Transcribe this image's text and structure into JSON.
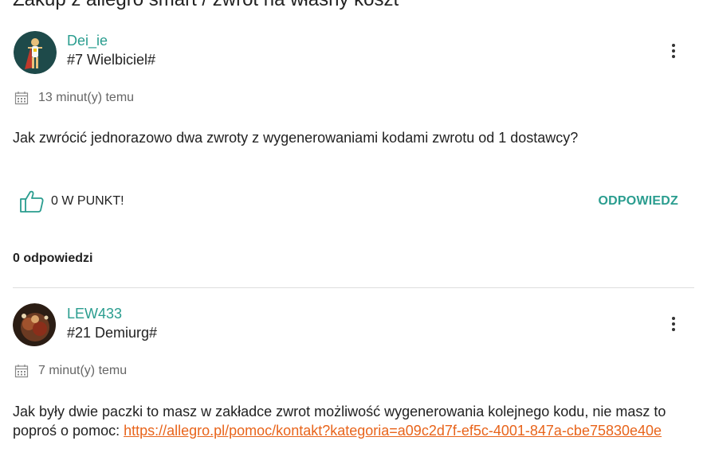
{
  "thread": {
    "title": "Zakup z allegro smart / zwrot na własny koszt"
  },
  "question": {
    "author": {
      "name": "Dei_ie",
      "rank": "#7 Wielbiciel#"
    },
    "time": "13 minut(y) temu",
    "text": "Jak zwrócić jednorazowo dwa zwroty z wygenerowaniami kodami zwrotu od 1 dostawcy?",
    "points_label": "0 W PUNKT!",
    "reply_label": "ODPOWIEDZ"
  },
  "answers_count_label": "0 odpowiedzi",
  "answer": {
    "author": {
      "name": "LEW433",
      "rank": "#21 Demiurg#"
    },
    "time": "7 minut(y) temu",
    "text": "Jak były dwie paczki to masz w zakładce zwrot możliwość wygenerowania kolejnego kodu, nie masz to poproś o pomoc: ",
    "link": "https://allegro.pl/pomoc/kontakt?kategoria=a09c2d7f-ef5c-4001-847a-cbe75830e40e"
  },
  "icons": {
    "menu": "more-vertical-icon",
    "calendar": "calendar-icon",
    "like": "thumbs-up-icon"
  },
  "colors": {
    "accent": "#2a9d8f",
    "link": "#e8641b"
  }
}
